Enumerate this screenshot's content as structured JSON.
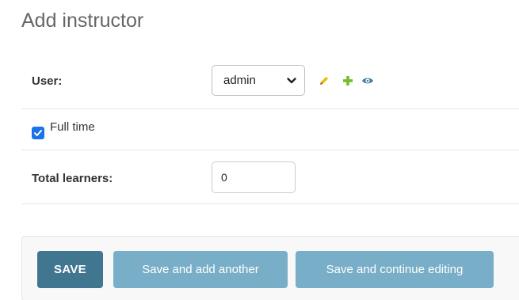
{
  "page": {
    "title": "Add instructor"
  },
  "form": {
    "user": {
      "label": "User:",
      "selected": "admin",
      "icons": [
        "pencil-icon",
        "plus-icon",
        "eye-icon"
      ]
    },
    "full_time": {
      "label": "Full time",
      "checked": true
    },
    "total_learners": {
      "label": "Total learners:",
      "value": "0"
    }
  },
  "actions": {
    "save": "SAVE",
    "save_add_another": "Save and add another",
    "save_continue": "Save and continue editing"
  },
  "colors": {
    "primary_button": "#417690",
    "secondary_button": "#79aec8",
    "checkbox": "#1a73e8",
    "edit_icon": "#efb80b",
    "add_icon": "#70bf2b",
    "view_icon": "#447e9b"
  }
}
